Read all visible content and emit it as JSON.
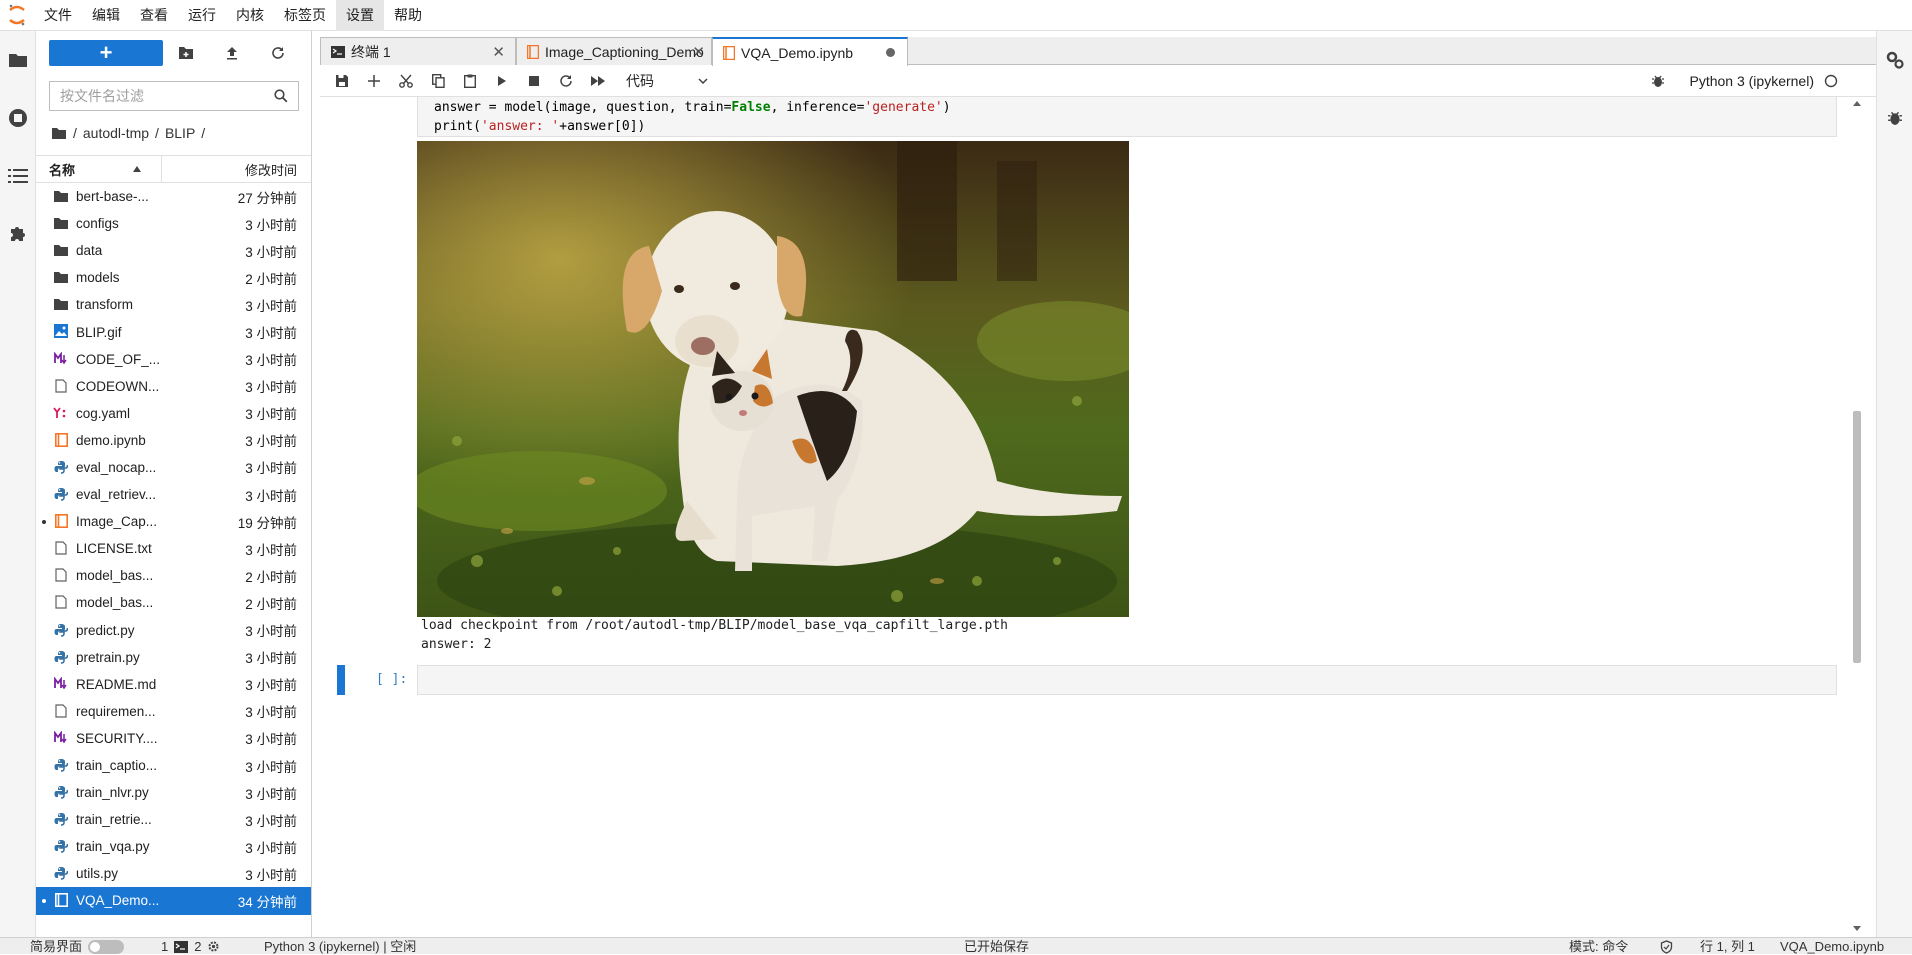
{
  "menu": [
    "文件",
    "编辑",
    "查看",
    "运行",
    "内核",
    "标签页",
    "设置",
    "帮助"
  ],
  "file_panel": {
    "filter_placeholder": "按文件名过滤",
    "breadcrumb": [
      "/",
      "autodl-tmp",
      "/",
      "BLIP",
      "/"
    ],
    "col_name": "名称",
    "col_modified": "修改时间",
    "files": [
      {
        "name": "bert-base-...",
        "time": "27 分钟前",
        "icon": "folder"
      },
      {
        "name": "configs",
        "time": "3 小时前",
        "icon": "folder"
      },
      {
        "name": "data",
        "time": "3 小时前",
        "icon": "folder"
      },
      {
        "name": "models",
        "time": "2 小时前",
        "icon": "folder"
      },
      {
        "name": "transform",
        "time": "3 小时前",
        "icon": "folder"
      },
      {
        "name": "BLIP.gif",
        "time": "3 小时前",
        "icon": "image"
      },
      {
        "name": "CODE_OF_...",
        "time": "3 小时前",
        "icon": "markdown"
      },
      {
        "name": "CODEOWN...",
        "time": "3 小时前",
        "icon": "file"
      },
      {
        "name": "cog.yaml",
        "time": "3 小时前",
        "icon": "yaml"
      },
      {
        "name": "demo.ipynb",
        "time": "3 小时前",
        "icon": "notebook"
      },
      {
        "name": "eval_nocap...",
        "time": "3 小时前",
        "icon": "python"
      },
      {
        "name": "eval_retriev...",
        "time": "3 小时前",
        "icon": "python"
      },
      {
        "name": "Image_Cap...",
        "time": "19 分钟前",
        "icon": "notebook",
        "running": true
      },
      {
        "name": "LICENSE.txt",
        "time": "3 小时前",
        "icon": "file"
      },
      {
        "name": "model_bas...",
        "time": "2 小时前",
        "icon": "file"
      },
      {
        "name": "model_bas...",
        "time": "2 小时前",
        "icon": "file"
      },
      {
        "name": "predict.py",
        "time": "3 小时前",
        "icon": "python"
      },
      {
        "name": "pretrain.py",
        "time": "3 小时前",
        "icon": "python"
      },
      {
        "name": "README.md",
        "time": "3 小时前",
        "icon": "markdown"
      },
      {
        "name": "requiremen...",
        "time": "3 小时前",
        "icon": "file"
      },
      {
        "name": "SECURITY....",
        "time": "3 小时前",
        "icon": "markdown"
      },
      {
        "name": "train_captio...",
        "time": "3 小时前",
        "icon": "python"
      },
      {
        "name": "train_nlvr.py",
        "time": "3 小时前",
        "icon": "python"
      },
      {
        "name": "train_retrie...",
        "time": "3 小时前",
        "icon": "python"
      },
      {
        "name": "train_vqa.py",
        "time": "3 小时前",
        "icon": "python"
      },
      {
        "name": "utils.py",
        "time": "3 小时前",
        "icon": "python"
      },
      {
        "name": "VQA_Demo...",
        "time": "34 分钟前",
        "icon": "notebook",
        "running": true,
        "selected": true
      }
    ]
  },
  "tabs": [
    {
      "label": "终端 1",
      "icon": "terminal-icon"
    },
    {
      "label": "Image_Captioning_Demo.ipy",
      "icon": "notebook-icon"
    },
    {
      "label": "VQA_Demo.ipynb",
      "icon": "notebook-icon",
      "active": true
    }
  ],
  "toolbar": {
    "cell_type": "代码",
    "kernel": "Python 3 (ipykernel)"
  },
  "code": {
    "line1_a": "answer = model(image, question, train=",
    "line1_b": "False",
    "line1_c": ", inference=",
    "line1_d": "'generate'",
    "line1_e": ")",
    "line2_a": "print(",
    "line2_b": "'answer: '",
    "line2_c": "+answer[0])"
  },
  "output": {
    "text": "load checkpoint from /root/autodl-tmp/BLIP/model_base_vqa_capfilt_large.pth\nanswer: 2"
  },
  "empty_prompt": "[ ]:",
  "status": {
    "simple_mode": "简易界面",
    "terminals": "1",
    "kernels": "2",
    "kernel_state": "Python 3 (ipykernel) | 空闲",
    "save_state": "已开始保存",
    "mode": "模式: 命令",
    "position": "行 1, 列 1",
    "filename": "VQA_Demo.ipynb"
  },
  "colors": {
    "accent": "#1976d2",
    "notebook_orange": "#f37726",
    "python_blue": "#3572a5",
    "markdown_purple": "#7a1fa2"
  }
}
